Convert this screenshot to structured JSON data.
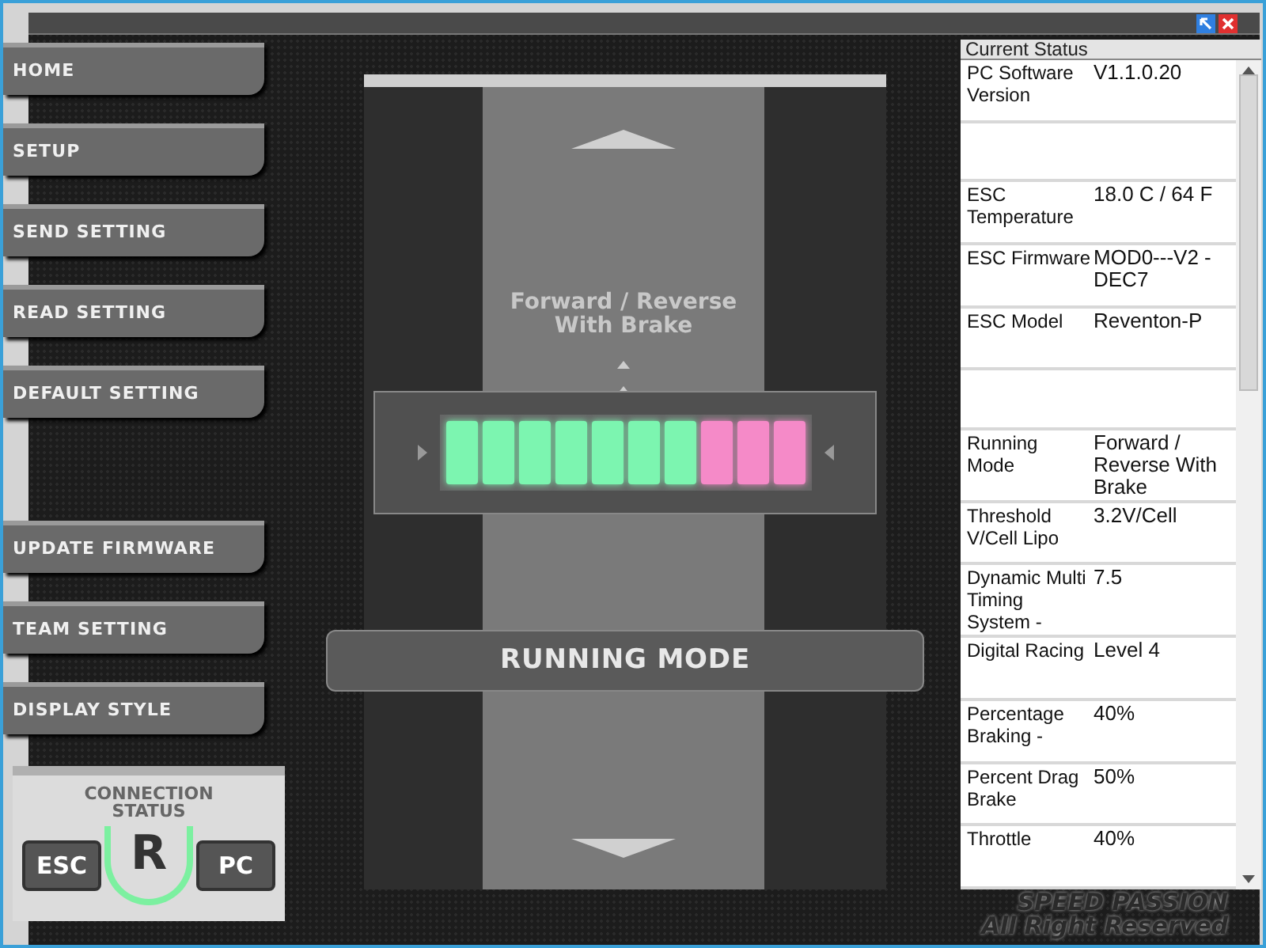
{
  "menu_top": [
    {
      "label": "HOME"
    },
    {
      "label": "SETUP"
    },
    {
      "label": "SEND SETTING"
    },
    {
      "label": "READ SETTING"
    },
    {
      "label": "DEFAULT SETTING"
    }
  ],
  "menu_bottom": [
    {
      "label": "UPDATE FIRMWARE"
    },
    {
      "label": "TEAM SETTING"
    },
    {
      "label": "DISPLAY STYLE"
    }
  ],
  "connection": {
    "title": "CONNECTION STATUS",
    "left": "ESC",
    "right": "PC",
    "logo": "R"
  },
  "mode_panel": {
    "mode_text": "Forward / Reverse With Brake",
    "button": "RUNNING MODE",
    "segments": [
      {
        "color": "#7cf5b0"
      },
      {
        "color": "#7cf5b0"
      },
      {
        "color": "#7cf5b0"
      },
      {
        "color": "#7cf5b0"
      },
      {
        "color": "#7cf5b0"
      },
      {
        "color": "#7cf5b0"
      },
      {
        "color": "#7cf5b0"
      },
      {
        "color": "#f58ac8"
      },
      {
        "color": "#f58ac8"
      },
      {
        "color": "#f58ac8"
      }
    ]
  },
  "status": {
    "title": "Current Status",
    "rows": [
      {
        "kind": "item",
        "label": "PC Software Version",
        "value": "V1.1.0.20"
      },
      {
        "kind": "blank"
      },
      {
        "kind": "item",
        "label": "ESC Temperature",
        "value": "18.0 C / 64 F"
      },
      {
        "kind": "item",
        "label": "ESC Firmware",
        "value": "MOD0---V2 -DEC7"
      },
      {
        "kind": "item",
        "label": "ESC Model",
        "value": "Reventon-P"
      },
      {
        "kind": "blank"
      },
      {
        "kind": "item",
        "label": "Running Mode",
        "value": "Forward / Reverse With Brake"
      },
      {
        "kind": "item",
        "label": "Threshold V/Cell Lipo",
        "value": "3.2V/Cell"
      },
      {
        "kind": "item",
        "label": "Dynamic Multi Timing System -",
        "value": "7.5"
      },
      {
        "kind": "item",
        "label": "Digital Racing",
        "value": "Level 4"
      },
      {
        "kind": "item",
        "label": "Percentage Braking -",
        "value": "40%"
      },
      {
        "kind": "item",
        "label": "Percent Drag Brake",
        "value": "50%"
      },
      {
        "kind": "item",
        "label": "Throttle",
        "value": "40%"
      }
    ]
  },
  "footer": {
    "line1": "SPEED PASSION",
    "line2": "All Right Reserved"
  }
}
